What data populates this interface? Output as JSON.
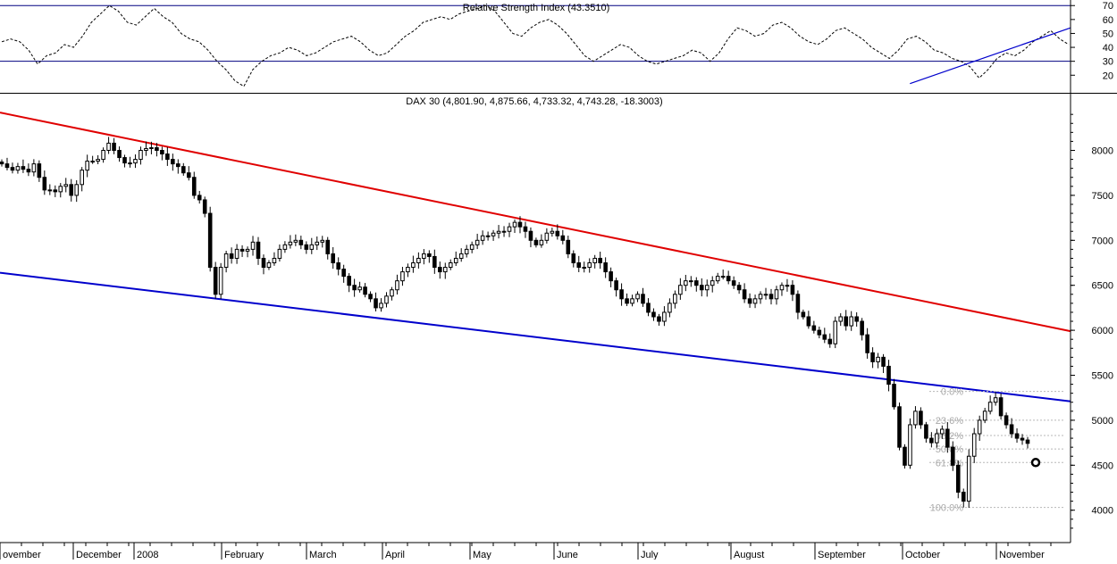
{
  "colors": {
    "background": "#ffffff",
    "candle": "#000000",
    "resistance_line": "#e00000",
    "support_line": "#0000cc",
    "rsi_band": "#000080",
    "fib_text": "#a8a8a8",
    "fib_line": "#b8b8b8"
  },
  "chart_data": [
    {
      "type": "line",
      "title": "Relative Strength Index (43.3510)",
      "y_ticks": [
        20,
        30,
        40,
        50,
        60,
        70
      ],
      "ylim": [
        8,
        74
      ],
      "band_levels": [
        30,
        70
      ],
      "series": [
        {
          "style": "dashed",
          "values": [
            44,
            46,
            44,
            38,
            28,
            34,
            36,
            42,
            40,
            48,
            58,
            64,
            70,
            66,
            58,
            56,
            62,
            68,
            62,
            58,
            50,
            46,
            44,
            38,
            30,
            24,
            16,
            12,
            24,
            30,
            34,
            36,
            40,
            38,
            34,
            36,
            40,
            44,
            46,
            48,
            44,
            38,
            34,
            36,
            42,
            48,
            52,
            58,
            60,
            62,
            60,
            64,
            66,
            68,
            70,
            66,
            58,
            50,
            48,
            54,
            58,
            60,
            56,
            50,
            42,
            34,
            30,
            34,
            38,
            42,
            40,
            34,
            30,
            28,
            30,
            32,
            34,
            38,
            36,
            30,
            36,
            46,
            54,
            52,
            48,
            50,
            56,
            58,
            54,
            48,
            44,
            42,
            46,
            52,
            54,
            50,
            46,
            40,
            36,
            32,
            38,
            46,
            48,
            44,
            38,
            36,
            32,
            30,
            26,
            18,
            24,
            32,
            36,
            34,
            38,
            44,
            48,
            52,
            46,
            42
          ]
        }
      ],
      "trendline": {
        "x": [
          0.85,
          1.0
        ],
        "y": [
          14,
          54
        ]
      }
    },
    {
      "type": "candlestick",
      "title": "DAX 30 (4,801.90, 4,875.66, 4,733.32, 4,743.28, -18.3003)",
      "y_ticks": [
        4000,
        4500,
        5000,
        5500,
        6000,
        6500,
        7000,
        7500,
        8000
      ],
      "ylim": [
        3640,
        8620
      ],
      "x_labels": [
        "ovember",
        "December",
        "2008",
        "February",
        "March",
        "April",
        "May",
        "June",
        "July",
        "August",
        "September",
        "October",
        "November"
      ],
      "closes": [
        7850,
        7810,
        7780,
        7820,
        7790,
        7760,
        7850,
        7700,
        7560,
        7560,
        7540,
        7600,
        7620,
        7500,
        7620,
        7780,
        7880,
        7880,
        7900,
        8000,
        8080,
        8000,
        7920,
        7860,
        7860,
        7900,
        8000,
        8020,
        8030,
        8000,
        7960,
        7900,
        7850,
        7820,
        7750,
        7700,
        7500,
        7450,
        7300,
        6700,
        6400,
        6700,
        6850,
        6800,
        6900,
        6880,
        6900,
        6980,
        6800,
        6700,
        6750,
        6800,
        6900,
        6950,
        6980,
        7000,
        6950,
        6900,
        6950,
        6980,
        7000,
        6850,
        6750,
        6680,
        6600,
        6500,
        6450,
        6480,
        6400,
        6350,
        6250,
        6300,
        6380,
        6450,
        6550,
        6650,
        6700,
        6750,
        6800,
        6850,
        6820,
        6700,
        6650,
        6700,
        6750,
        6800,
        6850,
        6900,
        6950,
        7000,
        7050,
        7050,
        7080,
        7100,
        7100,
        7150,
        7200,
        7150,
        7100,
        7000,
        6950,
        7000,
        7080,
        7100,
        7050,
        7000,
        6850,
        6750,
        6700,
        6700,
        6750,
        6800,
        6750,
        6650,
        6550,
        6450,
        6350,
        6300,
        6350,
        6400,
        6300,
        6200,
        6150,
        6100,
        6200,
        6300,
        6400,
        6500,
        6550,
        6550,
        6500,
        6450,
        6500,
        6550,
        6600,
        6600,
        6550,
        6500,
        6450,
        6350,
        6300,
        6350,
        6400,
        6400,
        6350,
        6450,
        6500,
        6500,
        6400,
        6200,
        6150,
        6050,
        6000,
        5950,
        5900,
        5850,
        6100,
        6150,
        6050,
        6150,
        6100,
        5950,
        5750,
        5650,
        5700,
        5600,
        5400,
        5150,
        4700,
        4500,
        4950,
        5100,
        4950,
        4800,
        4750,
        4850,
        4900,
        4700,
        4500,
        4200,
        4100,
        4600,
        4850,
        5000,
        5100,
        5200,
        5250,
        5050,
        4950,
        4850,
        4800,
        4780,
        4743
      ],
      "resistance_line": {
        "x": [
          0.0,
          1.0
        ],
        "y": [
          8420,
          5990
        ]
      },
      "support_line": {
        "x": [
          0.0,
          1.0
        ],
        "y": [
          6640,
          5210
        ]
      },
      "fibonacci": {
        "levels": [
          {
            "label": "0.0%",
            "price": 5320
          },
          {
            "label": "23.6%",
            "price": 5000
          },
          {
            "label": "38.2%",
            "price": 4830
          },
          {
            "label": "50.0%",
            "price": 4680
          },
          {
            "label": "61.8%",
            "price": 4530
          },
          {
            "label": "100.0%",
            "price": 4030
          }
        ]
      }
    }
  ]
}
